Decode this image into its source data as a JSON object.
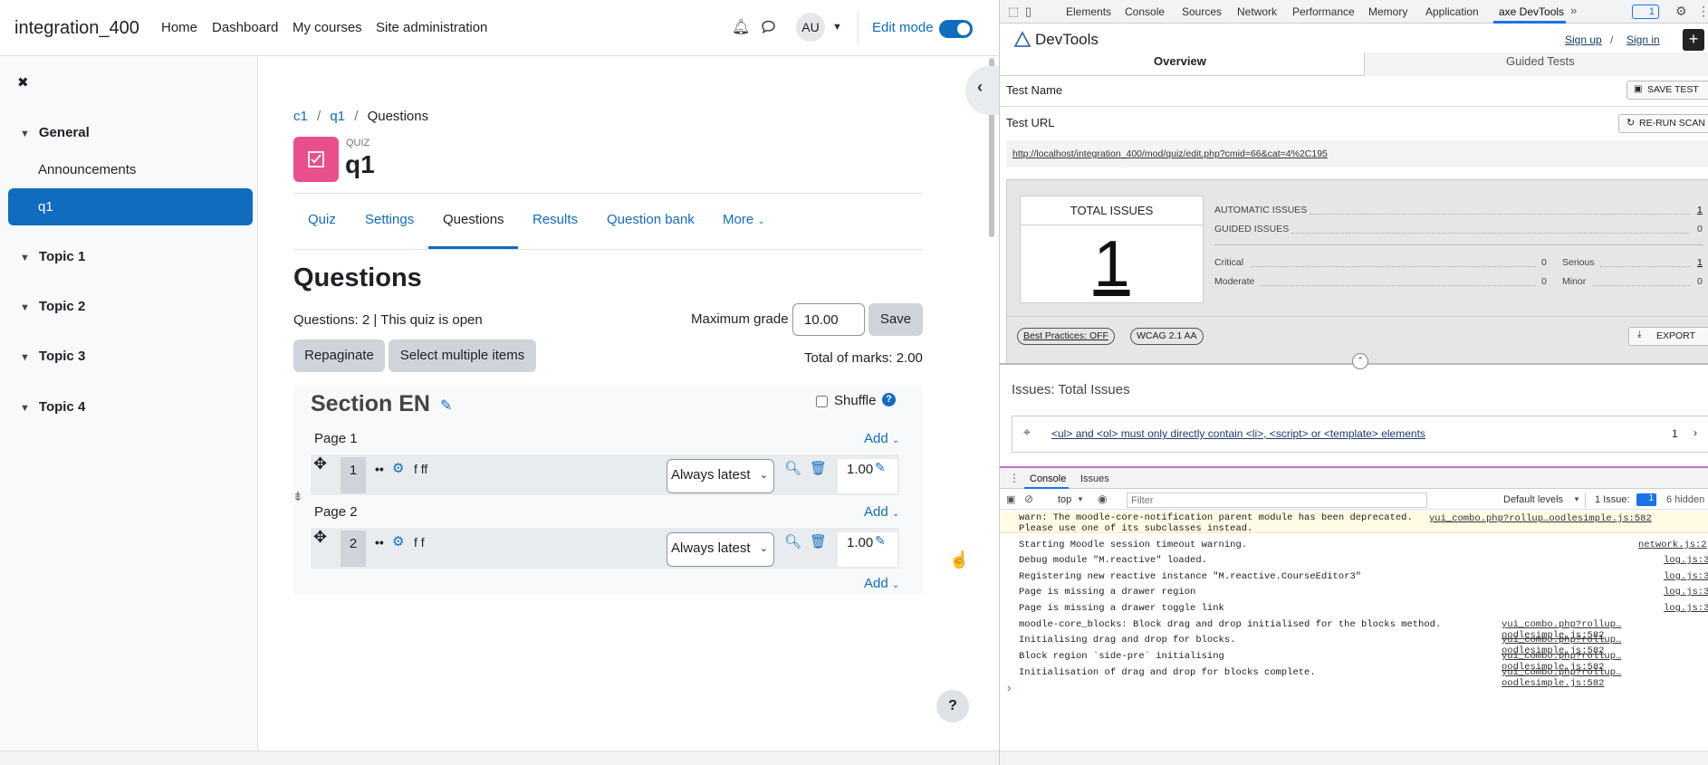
{
  "navbar": {
    "brand": "integration_400",
    "links": [
      "Home",
      "Dashboard",
      "My courses",
      "Site administration"
    ],
    "avatar": "AU",
    "edit_mode_label": "Edit mode"
  },
  "drawer": {
    "close_label": "✖",
    "sections": [
      {
        "label": "General",
        "items": [
          "Announcements",
          "q1"
        ]
      },
      {
        "label": "Topic 1"
      },
      {
        "label": "Topic 2"
      },
      {
        "label": "Topic 3"
      },
      {
        "label": "Topic 4"
      }
    ]
  },
  "breadcrumb": [
    "c1",
    "q1",
    "Questions"
  ],
  "quiz": {
    "type_label": "QUIZ",
    "title": "q1",
    "tabs": [
      "Quiz",
      "Settings",
      "Questions",
      "Results",
      "Question bank",
      "More"
    ],
    "active_tab": "Questions",
    "heading": "Questions",
    "status": "Questions: 2 | This quiz is open",
    "max_grade_label": "Maximum grade",
    "max_grade_value": "10.00",
    "save_label": "Save",
    "repaginate_label": "Repaginate",
    "select_multiple_label": "Select multiple items",
    "total_marks": "Total of marks: 2.00",
    "section_title": "Section EN",
    "shuffle_label": "Shuffle",
    "add_label": "Add",
    "pages": [
      {
        "label": "Page 1",
        "question": {
          "num": "1",
          "name": "f ff",
          "version": "Always latest",
          "mark": "1.00"
        }
      },
      {
        "label": "Page 2",
        "question": {
          "num": "2",
          "name": "f f",
          "version": "Always latest",
          "mark": "1.00"
        }
      }
    ],
    "help_label": "?"
  },
  "devtools": {
    "tabs": [
      "Elements",
      "Console",
      "Sources",
      "Network",
      "Performance",
      "Memory",
      "Application",
      "axe DevTools"
    ],
    "active_tab": "axe DevTools",
    "badge": "1",
    "axe": {
      "title": "DevTools",
      "sign_up": "Sign up",
      "sign_in": "Sign in",
      "sub_tabs": [
        "Overview",
        "Guided Tests"
      ],
      "test_name_label": "Test Name",
      "save_test": "SAVE TEST",
      "test_url_label": "Test URL",
      "rerun": "RE-RUN SCAN",
      "url": "http://localhost/integration_400/mod/quiz/edit.php?cmid=66&cat=4%2C195",
      "total_issues_label": "TOTAL ISSUES",
      "total_issues": "1",
      "automatic_label": "AUTOMATIC ISSUES",
      "automatic": "1",
      "guided_label": "GUIDED ISSUES",
      "guided": "0",
      "critical_label": "Critical",
      "critical": "0",
      "serious_label": "Serious",
      "serious": "1",
      "moderate_label": "Moderate",
      "moderate": "0",
      "minor_label": "Minor",
      "minor": "0",
      "best_practices": "Best Practices: OFF",
      "wcag": "WCAG 2.1 AA",
      "export": "EXPORT",
      "issues_heading": "Issues: Total Issues",
      "issue_text": "<ul> and <ol> must only directly contain <li>, <script> or <template> elements",
      "issue_count": "1"
    },
    "console": {
      "tabs": [
        "Console",
        "Issues"
      ],
      "context": "top",
      "filter_placeholder": "Filter",
      "levels": "Default levels",
      "issue_badge": "1 Issue:",
      "issue_badge_count": "1",
      "hidden": "6 hidden",
      "lines": [
        {
          "text": "warn: The moodle-core-notification parent module has been deprecated. Please use one of its subclasses instead.",
          "src": "yui_combo.php?rollup…oodlesimple.js:582"
        },
        {
          "text": "Starting Moodle session timeout warning.",
          "src": "network.js:2"
        },
        {
          "text": "Debug module \"M.reactive\" loaded.",
          "src": "log.js:3"
        },
        {
          "text": "Registering new reactive instance \"M.reactive.CourseEditor3\"",
          "src": "log.js:3"
        },
        {
          "text": "Page is missing a drawer region",
          "src": "log.js:3"
        },
        {
          "text": "Page is missing a drawer toggle link",
          "src": "log.js:3"
        },
        {
          "text": "moodle-core_blocks: Block drag and drop initialised for the blocks method.",
          "src": "yui_combo.php?rollup…oodlesimple.js:582"
        },
        {
          "text": "Initialising drag and drop for blocks.",
          "src": "yui_combo.php?rollup…oodlesimple.js:582"
        },
        {
          "text": "Block region `side-pre` initialising",
          "src": "yui_combo.php?rollup…oodlesimple.js:582"
        },
        {
          "text": "Initialisation of drag and drop for blocks complete.",
          "src": "yui_combo.php?rollup…oodlesimple.js:582"
        }
      ],
      "prompt": "›"
    }
  }
}
